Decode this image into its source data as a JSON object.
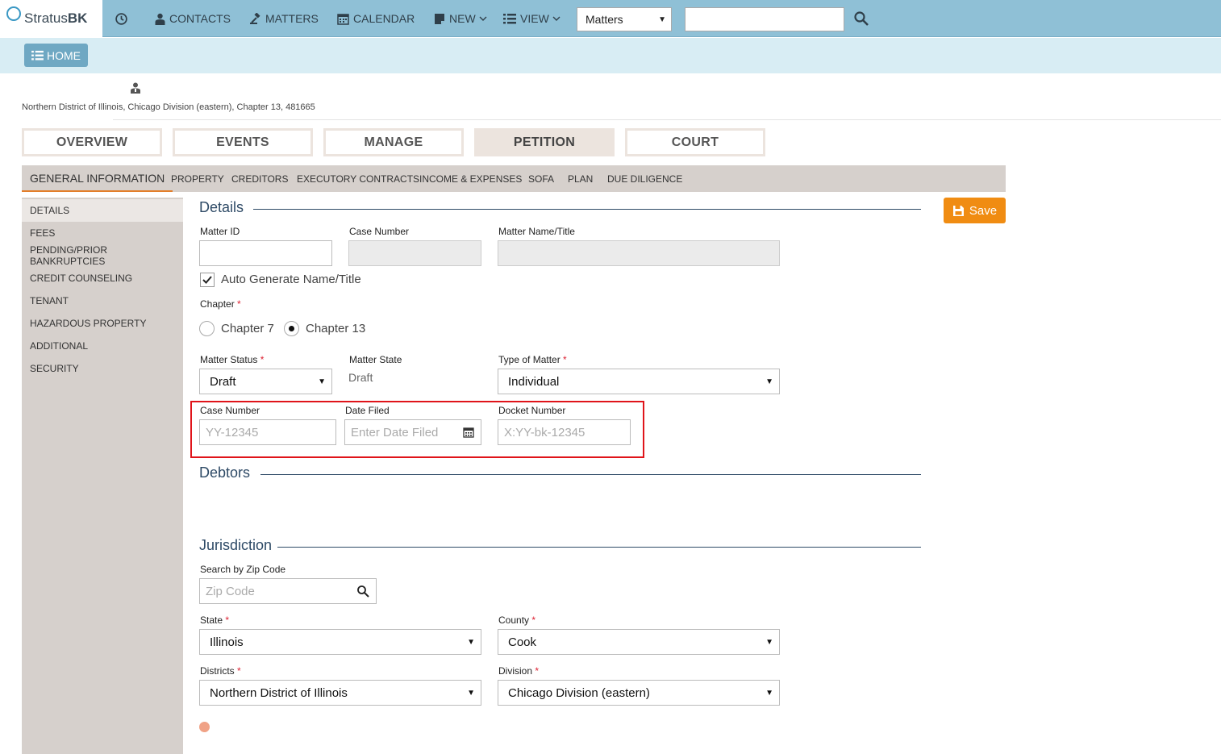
{
  "app": {
    "logo_text_1": "Stratus",
    "logo_text_2": "BK"
  },
  "nav": {
    "history_icon": "history-icon",
    "contacts": "CONTACTS",
    "matters": "MATTERS",
    "calendar": "CALENDAR",
    "new": "NEW",
    "view": "VIEW",
    "search_scope": "Matters",
    "search_value": ""
  },
  "home_button": "HOME",
  "breadcrumb": "Northern District of Illinois, Chicago Division (eastern), Chapter 13, 481665",
  "main_tabs": [
    "OVERVIEW",
    "EVENTS",
    "MANAGE",
    "PETITION",
    "COURT"
  ],
  "active_main_tab": "PETITION",
  "sub_tabs": [
    "GENERAL INFORMATION",
    "PROPERTY",
    "CREDITORS",
    "EXECUTORY CONTRACTS",
    "INCOME & EXPENSES",
    "SOFA",
    "PLAN",
    "DUE DILIGENCE"
  ],
  "sidebar": [
    "DETAILS",
    "FEES",
    "PENDING/PRIOR BANKRUPTCIES",
    "CREDIT COUNSELING",
    "TENANT",
    "HAZARDOUS PROPERTY",
    "ADDITIONAL",
    "SECURITY"
  ],
  "save_label": "Save",
  "details": {
    "title": "Details",
    "matter_id_label": "Matter ID",
    "matter_id_value": "",
    "case_number_label": "Case Number",
    "case_number_value": "",
    "matter_name_label": "Matter Name/Title",
    "matter_name_value": "",
    "auto_generate_label": "Auto Generate Name/Title",
    "auto_generate_checked": true,
    "chapter_label": "Chapter",
    "chapter_options": [
      "Chapter 7",
      "Chapter 13"
    ],
    "chapter_selected": "Chapter 13",
    "matter_status_label": "Matter Status",
    "matter_status_value": "Draft",
    "matter_state_label": "Matter State",
    "matter_state_value": "Draft",
    "type_of_matter_label": "Type of Matter",
    "type_of_matter_value": "Individual",
    "case_number2_label": "Case Number",
    "case_number2_placeholder": "YY-12345",
    "date_filed_label": "Date Filed",
    "date_filed_placeholder": "Enter Date Filed",
    "docket_number_label": "Docket Number",
    "docket_number_placeholder": "X:YY-bk-12345",
    "required_mark": "*"
  },
  "debtors": {
    "title": "Debtors"
  },
  "jurisdiction": {
    "title": "Jurisdiction",
    "zip_label": "Search by Zip Code",
    "zip_placeholder": "Zip Code",
    "state_label": "State",
    "state_value": "Illinois",
    "county_label": "County",
    "county_value": "Cook",
    "districts_label": "Districts",
    "districts_value": "Northern District of Illinois",
    "division_label": "Division",
    "division_value": "Chicago Division (eastern)"
  },
  "colors": {
    "topbar": "#8fc0d6",
    "subbar": "#d8edf4",
    "accent_orange": "#f08c12",
    "highlight_red": "#e0141a",
    "heading_blue": "#2e4a66"
  }
}
